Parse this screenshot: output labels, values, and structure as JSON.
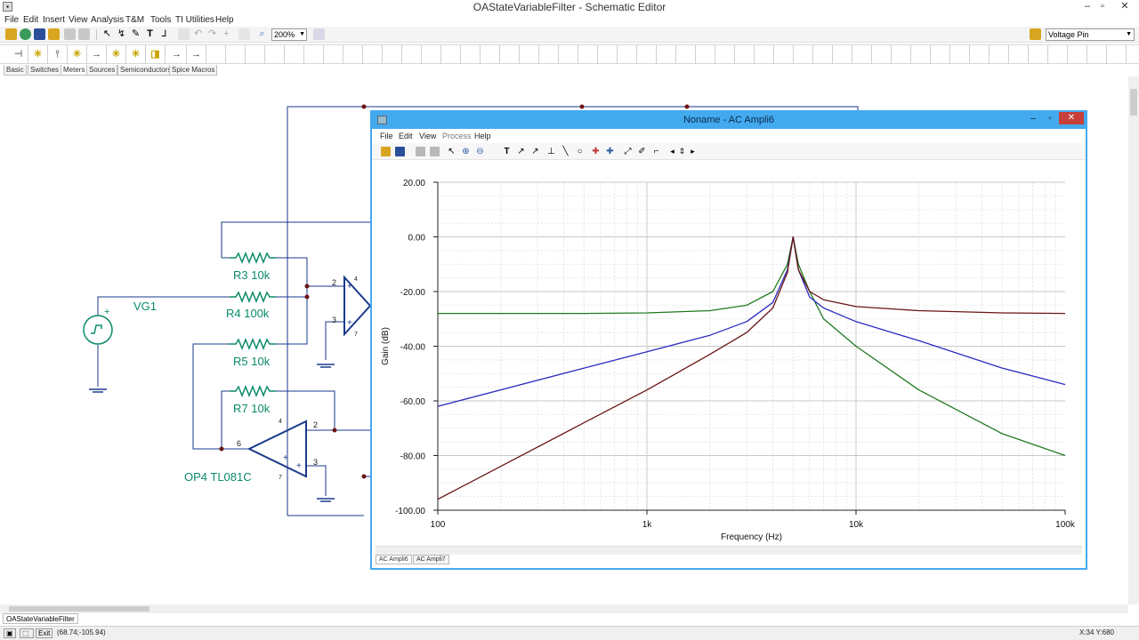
{
  "app": {
    "title": "OAStateVariableFilter - Schematic Editor",
    "window_controls": [
      "–",
      "▫",
      "✕"
    ]
  },
  "menu": [
    "File",
    "Edit",
    "Insert",
    "View",
    "Analysis",
    "T&M",
    "Tools",
    "TI Utilities",
    "Help"
  ],
  "toolbar": {
    "zoom": "200%",
    "pin_type": "Voltage Pin",
    "colors": {
      "folder": "#d9a520",
      "save": "#2a4e9a",
      "zoom": "#3b7bc6",
      "text_tool": "#222222"
    }
  },
  "component_tabs": [
    "Basic",
    "Switches",
    "Meters",
    "Sources",
    "Semiconductors",
    "Spice Macros"
  ],
  "active_component_tab": "Meters",
  "schematic": {
    "labels": {
      "vg1": "VG1",
      "r3": "R3 10k",
      "r4": "R4 100k",
      "r5": "R5 10k",
      "r7": "R7 10k",
      "op4": "OP4 TL081C",
      "plus": "+"
    },
    "pins": {
      "p2a": "2",
      "p3a": "3",
      "p4a": "4",
      "p7a": "7",
      "p2b": "2",
      "p3b": "3",
      "p6b": "6",
      "p4b": "4",
      "p7b": "7"
    },
    "wire_color": "#1a3a8a",
    "component_color": "#0a8a6a",
    "label_color": "#0a8a6a"
  },
  "ac_window": {
    "title": "Noname - AC Ampli6",
    "menu": [
      "File",
      "Edit",
      "View",
      "Process",
      "Help"
    ],
    "tabs": [
      "AC Ampli6",
      "AC Ampli7"
    ],
    "active_tab": "AC Ampli6",
    "accent": "#44aaf0"
  },
  "chart_data": {
    "type": "line",
    "xlabel": "Frequency (Hz)",
    "ylabel": "Gain (dB)",
    "x_scale": "log",
    "xlim": [
      100,
      100000
    ],
    "ylim": [
      -100,
      20
    ],
    "x_ticks": [
      {
        "v": 100,
        "label": "100"
      },
      {
        "v": 1000,
        "label": "1k"
      },
      {
        "v": 10000,
        "label": "10k"
      },
      {
        "v": 100000,
        "label": "100k"
      }
    ],
    "y_ticks": [
      {
        "v": 20,
        "label": "20.00"
      },
      {
        "v": 0,
        "label": "0.00"
      },
      {
        "v": -20,
        "label": "-20.00"
      },
      {
        "v": -40,
        "label": "-40.00"
      },
      {
        "v": -60,
        "label": "-60.00"
      },
      {
        "v": -80,
        "label": "-80.00"
      },
      {
        "v": -100,
        "label": "-100.00"
      }
    ],
    "grid": true,
    "legend": "none",
    "series": [
      {
        "color": "#1f7a1f",
        "role": "lowpass",
        "x": [
          100,
          500,
          1000,
          2000,
          3000,
          4000,
          4700,
          5000,
          5300,
          6000,
          7000,
          10000,
          20000,
          50000,
          100000
        ],
        "y": [
          -28,
          -28,
          -27.8,
          -27,
          -25,
          -20,
          -10,
          0,
          -10,
          -20,
          -30,
          -40,
          -56,
          -72,
          -80
        ]
      },
      {
        "color": "#2b2bc0",
        "role": "bandpass",
        "x": [
          100,
          500,
          1000,
          2000,
          3000,
          4000,
          4700,
          5000,
          5300,
          6000,
          7000,
          10000,
          20000,
          50000,
          100000
        ],
        "y": [
          -62,
          -48,
          -42,
          -36,
          -31,
          -24,
          -12,
          0,
          -12,
          -22,
          -26,
          -31,
          -38,
          -48,
          -54
        ]
      },
      {
        "color": "#6a1414",
        "role": "highpass",
        "x": [
          100,
          500,
          1000,
          2000,
          3000,
          4000,
          4700,
          5000,
          5300,
          6000,
          7000,
          10000,
          20000,
          50000,
          100000
        ],
        "y": [
          -96,
          -68,
          -56,
          -43,
          -35,
          -26,
          -13,
          0,
          -12,
          -20,
          -23,
          -25.5,
          -27,
          -27.8,
          -28
        ]
      }
    ]
  },
  "status": {
    "coords": "(68.74;-105.94)",
    "exit": "Exit",
    "xy": "X:34  Y:680"
  },
  "doc_tab": "OAStateVariableFilter"
}
